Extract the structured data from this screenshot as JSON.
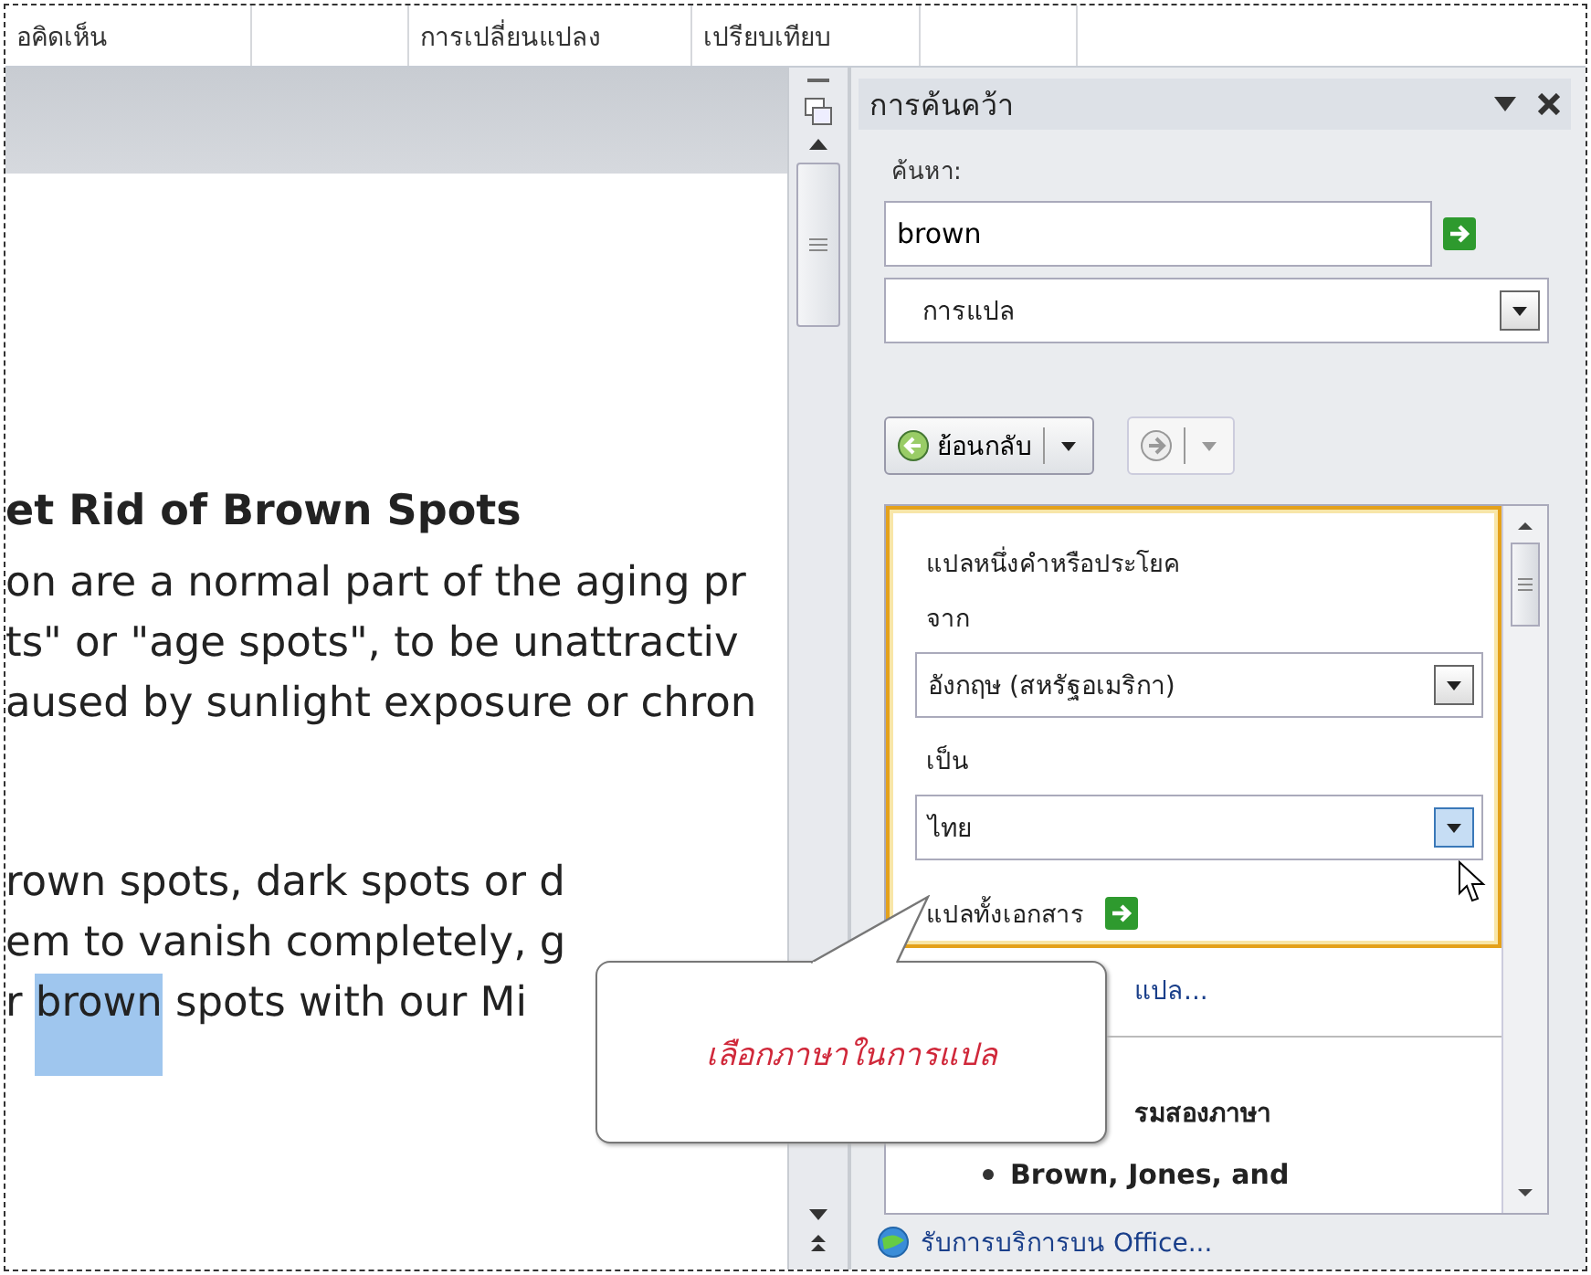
{
  "ribbon_tabs": [
    "อคิดเห็น",
    "การเปลี่ยนแปลง",
    "เปรียบเทียบ"
  ],
  "document": {
    "heading": "et Rid of Brown Spots",
    "paragraphs": [
      [
        [
          {
            "text": "on are a normal part of the aging pr",
            "selected": false
          }
        ],
        [
          {
            "text": "ts\" or \"age spots\", to be unattractiv",
            "selected": false
          }
        ],
        [
          {
            "text": "aused by sunlight exposure or chron",
            "selected": false
          }
        ]
      ],
      [
        [
          {
            "text": "rown spots, dark spots or d",
            "selected": false
          }
        ],
        [
          {
            "text": "em to vanish completely, g",
            "selected": false
          }
        ],
        [
          {
            "text": "r ",
            "selected": false
          },
          {
            "text": "brown",
            "selected": true
          },
          {
            "text": " spots with our Mi",
            "selected": false
          }
        ]
      ]
    ]
  },
  "research_pane": {
    "title": "การค้นคว้า",
    "search_label": "ค้นหา:",
    "search_value": "brown",
    "service": "การแปล",
    "back_label": "ย้อนกลับ",
    "forward_disabled": true,
    "translate": {
      "heading": "แปลหนึ่งคำหรือประโยค",
      "from_label": "จาก",
      "from_value": "อังกฤษ (สหรัฐอเมริกา)",
      "to_label": "เป็น",
      "to_value": "ไทย",
      "to_hovered": true,
      "whole_doc": "แปลทั้งเอกสาร"
    },
    "options_link": "แปล...",
    "bilingual_heading": "รมสองภาษา",
    "results": [
      "Brown, Jones, and"
    ],
    "footer_link": "รับการบริการบน Office..."
  },
  "callout": {
    "text": "เลือกภาษาในการแปล"
  }
}
